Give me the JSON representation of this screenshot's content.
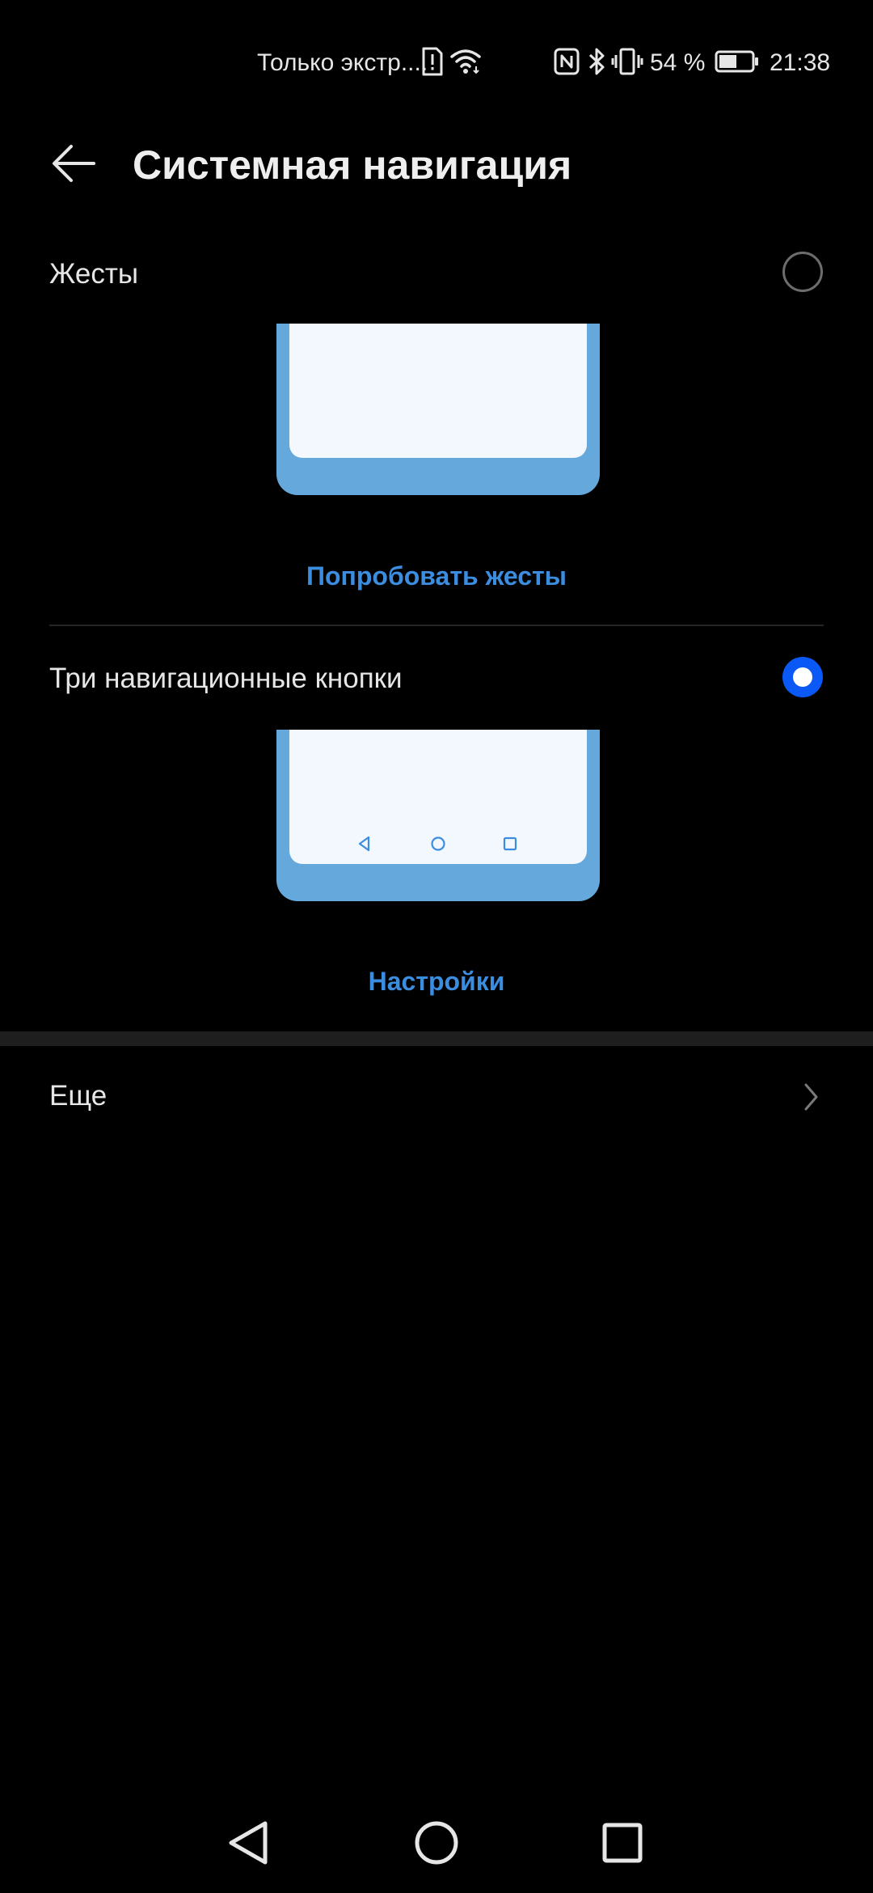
{
  "status_bar": {
    "network_text": "Только экстр....",
    "battery_percent": "54 %",
    "time": "21:38",
    "battery_level": 0.54,
    "icons": [
      "alert-sim-icon",
      "wifi-icon",
      "nfc-icon",
      "bluetooth-icon",
      "vibrate-icon",
      "battery-icon"
    ]
  },
  "header": {
    "back_icon": "arrow-left-icon",
    "title": "Системная навигация"
  },
  "options": [
    {
      "label": "Жесты",
      "selected": false,
      "action_label": "Попробовать жесты"
    },
    {
      "label": "Три навигационные кнопки",
      "selected": true,
      "action_label": "Настройки",
      "preview_icons": [
        "triangle-back-icon",
        "circle-home-icon",
        "square-recents-icon"
      ]
    }
  ],
  "more": {
    "label": "Еще",
    "icon": "chevron-right-icon"
  },
  "navigation_bar": {
    "icons": [
      "back-icon",
      "home-icon",
      "recents-icon"
    ]
  },
  "colors": {
    "accent": "#0a59f7",
    "link": "#3b8de0",
    "illustration": "#64a8dc",
    "background": "#000000"
  }
}
